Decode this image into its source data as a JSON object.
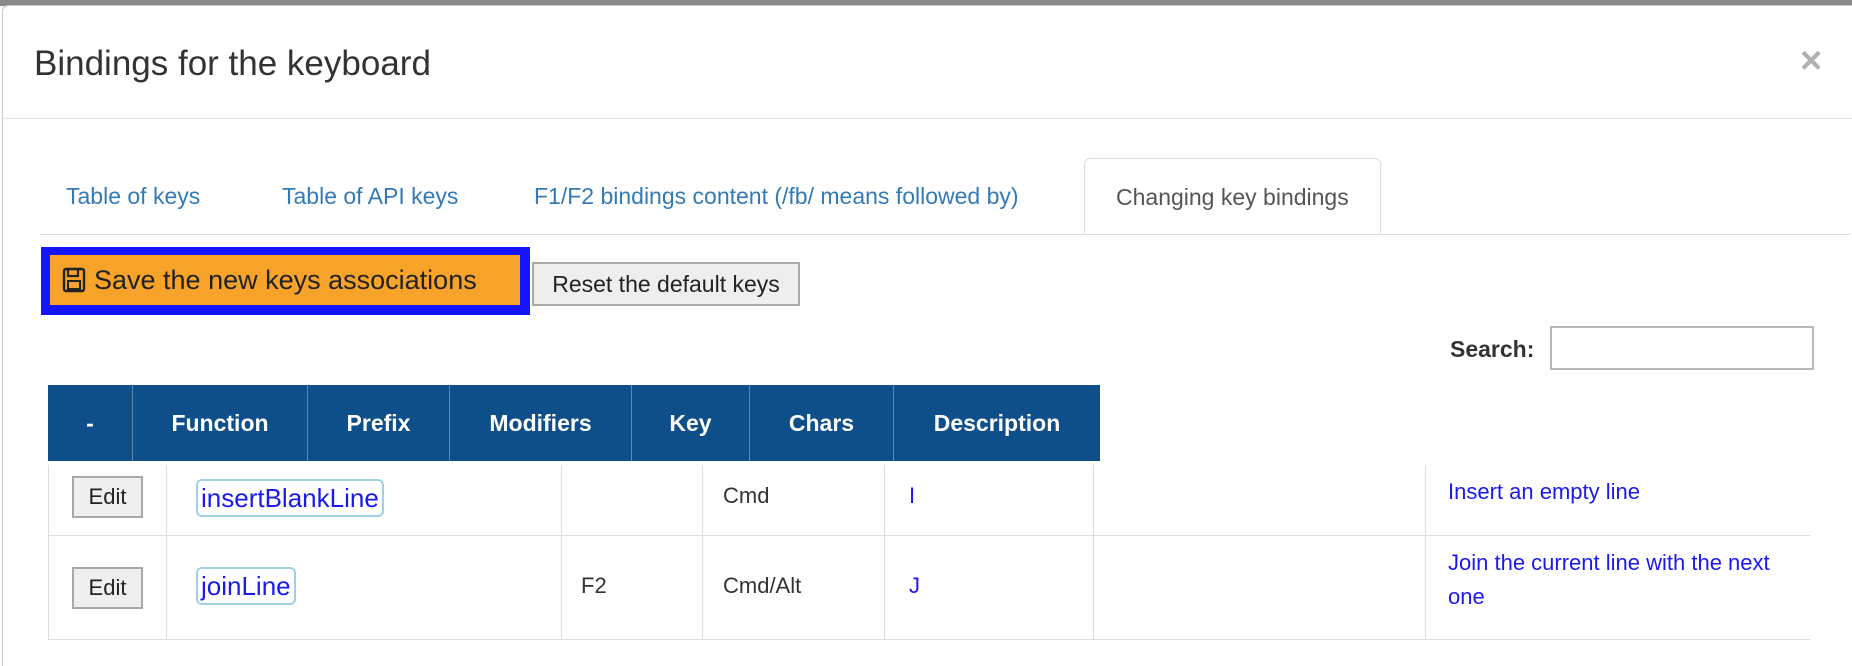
{
  "modal": {
    "title": "Bindings for the keyboard",
    "close_symbol": "×"
  },
  "tabs": [
    {
      "label": "Table of keys"
    },
    {
      "label": "Table of API keys"
    },
    {
      "label": "F1/F2 bindings content (/fb/ means followed by)"
    },
    {
      "label": "Changing key bindings",
      "active": true
    }
  ],
  "toolbar": {
    "save_label": "Save the new keys associations",
    "save_icon": "floppy-disk-icon",
    "reset_label": "Reset the default keys"
  },
  "search": {
    "label": "Search:",
    "value": ""
  },
  "table": {
    "columns": [
      "-",
      "Function",
      "Prefix",
      "Modifiers",
      "Key",
      "Chars",
      "Description"
    ],
    "rows": [
      {
        "edit_label": "Edit",
        "function": "insertBlankLine",
        "prefix": "",
        "modifiers": "Cmd",
        "key": "I",
        "chars": "",
        "description": "Insert an empty line"
      },
      {
        "edit_label": "Edit",
        "function": "joinLine",
        "prefix": "F2",
        "modifiers": "Cmd/Alt",
        "key": "J",
        "chars": "",
        "description": "Join the current line with the next one"
      }
    ]
  },
  "colors": {
    "header_bg": "#0e4f8a",
    "save_bg": "#f7a32a",
    "focus_outline": "#1414ff",
    "link": "#337ab7"
  }
}
